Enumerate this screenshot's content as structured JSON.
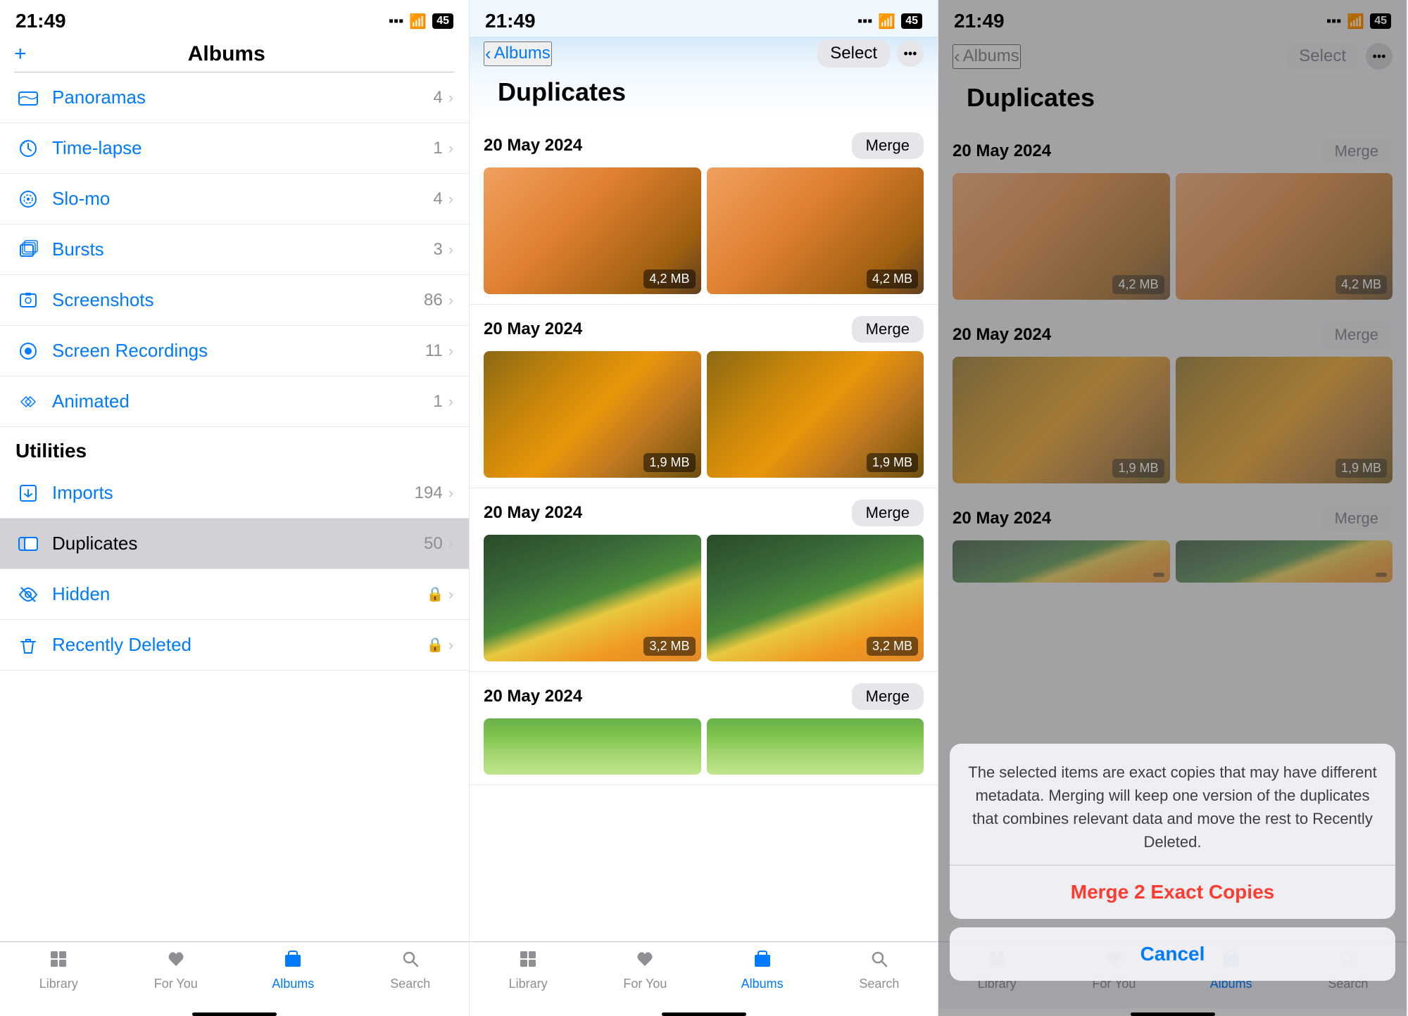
{
  "panels": [
    {
      "id": "albums",
      "status_time": "21:49",
      "nav_add_icon": "+",
      "nav_title": "Albums",
      "sections": [
        {
          "header": null,
          "items": [
            {
              "id": "panoramas",
              "icon": "panorama",
              "label": "Panoramas",
              "count": "4",
              "has_lock": false
            },
            {
              "id": "timelapse",
              "icon": "timelapse",
              "label": "Time-lapse",
              "count": "1",
              "has_lock": false
            },
            {
              "id": "slomo",
              "icon": "slomo",
              "label": "Slo-mo",
              "count": "4",
              "has_lock": false
            },
            {
              "id": "bursts",
              "icon": "bursts",
              "label": "Bursts",
              "count": "3",
              "has_lock": false
            },
            {
              "id": "screenshots",
              "icon": "screenshots",
              "label": "Screenshots",
              "count": "86",
              "has_lock": false
            },
            {
              "id": "screen-recordings",
              "icon": "screen-recordings",
              "label": "Screen Recordings",
              "count": "11",
              "has_lock": false
            },
            {
              "id": "animated",
              "icon": "animated",
              "label": "Animated",
              "count": "1",
              "has_lock": false
            }
          ]
        },
        {
          "header": "Utilities",
          "items": [
            {
              "id": "imports",
              "icon": "imports",
              "label": "Imports",
              "count": "194",
              "has_lock": false
            },
            {
              "id": "duplicates",
              "icon": "duplicates",
              "label": "Duplicates",
              "count": "50",
              "has_lock": false,
              "highlighted": true
            },
            {
              "id": "hidden",
              "icon": "hidden",
              "label": "Hidden",
              "count": "",
              "has_lock": true
            },
            {
              "id": "recently-deleted",
              "icon": "recently-deleted",
              "label": "Recently Deleted",
              "count": "",
              "has_lock": true
            }
          ]
        }
      ],
      "tab_bar": {
        "items": [
          {
            "id": "library",
            "label": "Library",
            "active": false
          },
          {
            "id": "for-you",
            "label": "For You",
            "active": false
          },
          {
            "id": "albums",
            "label": "Albums",
            "active": true
          },
          {
            "id": "search",
            "label": "Search",
            "active": false
          }
        ]
      }
    },
    {
      "id": "duplicates-list",
      "status_time": "21:49",
      "nav_back_label": "Albums",
      "nav_select_label": "Select",
      "nav_title": "Duplicates",
      "groups": [
        {
          "date": "20 May 2024",
          "size1": "4,2 MB",
          "size2": "4,2 MB",
          "photo_class1": "photo-block-1",
          "photo_class2": "photo-block-1"
        },
        {
          "date": "20 May 2024",
          "size1": "1,9 MB",
          "size2": "1,9 MB",
          "photo_class1": "photo-block-2",
          "photo_class2": "photo-block-2"
        },
        {
          "date": "20 May 2024",
          "size1": "3,2 MB",
          "size2": "3,2 MB",
          "photo_class1": "photo-block-3",
          "photo_class2": "photo-block-3"
        },
        {
          "date": "20 May 2024",
          "size1": "",
          "size2": "",
          "photo_class1": "photo-block-partial",
          "photo_class2": "photo-block-partial",
          "partial": true
        }
      ],
      "merge_label": "Merge",
      "tab_bar": {
        "items": [
          {
            "id": "library",
            "label": "Library",
            "active": false
          },
          {
            "id": "for-you",
            "label": "For You",
            "active": false
          },
          {
            "id": "albums",
            "label": "Albums",
            "active": true
          },
          {
            "id": "search",
            "label": "Search",
            "active": false
          }
        ]
      }
    },
    {
      "id": "duplicates-modal",
      "status_time": "21:49",
      "nav_back_label": "Albums",
      "nav_select_label": "Select",
      "nav_title": "Duplicates",
      "groups": [
        {
          "date": "20 May 2024",
          "size1": "4,2 MB",
          "size2": "4,2 MB",
          "photo_class1": "photo-block-1",
          "photo_class2": "photo-block-1"
        },
        {
          "date": "20 May 2024",
          "size1": "1,9 MB",
          "size2": "1,9 MB",
          "photo_class1": "photo-block-2",
          "photo_class2": "photo-block-2"
        },
        {
          "date": "20 May 2024",
          "size1": "",
          "size2": "",
          "photo_class1": "photo-block-3",
          "photo_class2": "photo-block-3",
          "partial_top": true
        }
      ],
      "merge_label": "Merge",
      "action_sheet": {
        "message": "The selected items are exact copies that may have different metadata. Merging will keep one version of the duplicates that combines relevant data and move the rest to Recently Deleted.",
        "confirm_label": "Merge 2 Exact Copies",
        "cancel_label": "Cancel"
      },
      "tab_bar": {
        "items": [
          {
            "id": "library",
            "label": "Library",
            "active": false
          },
          {
            "id": "for-you",
            "label": "For You",
            "active": false
          },
          {
            "id": "albums",
            "label": "Albums",
            "active": true
          },
          {
            "id": "search",
            "label": "Search",
            "active": false
          }
        ]
      }
    }
  ]
}
